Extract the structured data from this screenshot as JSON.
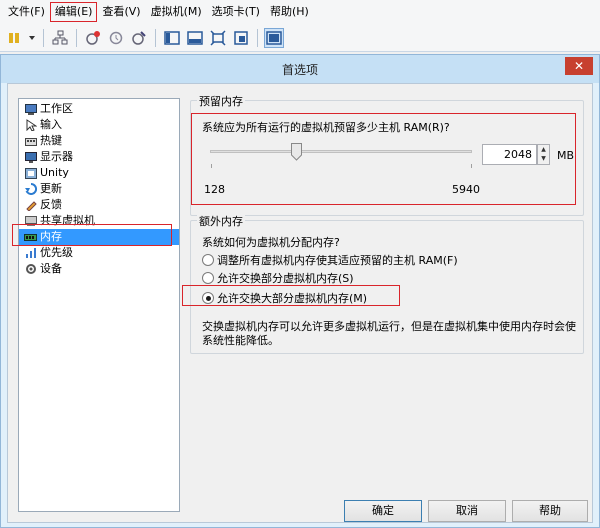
{
  "menu": {
    "items": [
      {
        "label": "文件(F)"
      },
      {
        "label": "编辑(E)"
      },
      {
        "label": "查看(V)"
      },
      {
        "label": "虚拟机(M)"
      },
      {
        "label": "选项卡(T)"
      },
      {
        "label": "帮助(H)"
      }
    ]
  },
  "dialog": {
    "title": "首选项",
    "close_glyph": "✕"
  },
  "tree": {
    "items": [
      {
        "label": "工作区",
        "icon": "workspace-icon"
      },
      {
        "label": "输入",
        "icon": "input-icon"
      },
      {
        "label": "热键",
        "icon": "hotkey-icon"
      },
      {
        "label": "显示器",
        "icon": "display-icon"
      },
      {
        "label": "Unity",
        "icon": "unity-icon"
      },
      {
        "label": "更新",
        "icon": "update-icon"
      },
      {
        "label": "反馈",
        "icon": "feedback-icon"
      },
      {
        "label": "共享虚拟机",
        "icon": "shared-vm-icon"
      },
      {
        "label": "内存",
        "icon": "memory-icon"
      },
      {
        "label": "优先级",
        "icon": "priority-icon"
      },
      {
        "label": "设备",
        "icon": "devices-icon"
      }
    ],
    "selected": "内存"
  },
  "reserved": {
    "group_label": "预留内存",
    "question": "系统应为所有运行的虚拟机预留多少主机 RAM(R)?",
    "value": "2048",
    "unit": "MB",
    "min_label": "128",
    "max_label": "5940"
  },
  "extra": {
    "group_label": "额外内存",
    "question": "系统如何为虚拟机分配内存?",
    "options": [
      {
        "label": "调整所有虚拟机内存使其适应预留的主机 RAM(F)",
        "checked": false
      },
      {
        "label": "允许交换部分虚拟机内存(S)",
        "checked": false
      },
      {
        "label": "允许交换大部分虚拟机内存(M)",
        "checked": true
      }
    ],
    "note_line1": "交换虚拟机内存可以允许更多虚拟机运行，但是在虚拟机集中使用内存时会使",
    "note_line2": "系统性能降低。"
  },
  "buttons": {
    "ok": "确定",
    "cancel": "取消",
    "help": "帮助"
  }
}
